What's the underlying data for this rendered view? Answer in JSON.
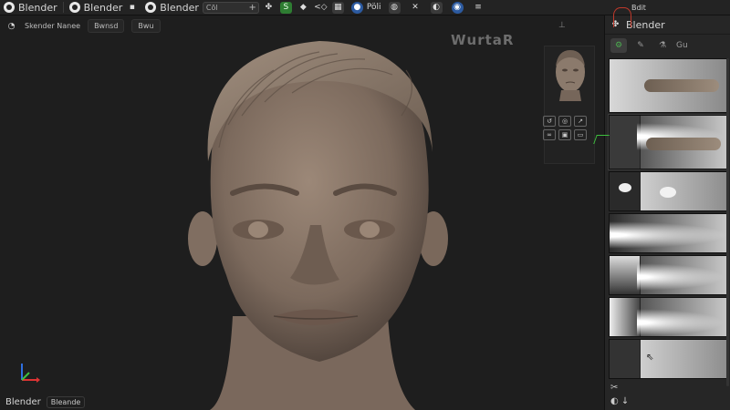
{
  "topbar": {
    "app_label_1": "Blender",
    "app_label_2": "Blender",
    "app_label_3": "Blender",
    "search_value": "Cõl",
    "right_label": "Pöli",
    "panel_label": "Bdit"
  },
  "viewport": {
    "header_left": "Skender Nanee",
    "header_chip": "Bwnsd",
    "header_chip_2": "Bwu",
    "watermark": "WurtaR",
    "footer_label": "Blender",
    "footer_sub": "Bleande"
  },
  "panel": {
    "title": "Blender",
    "tab_label": "Gu"
  },
  "colors": {
    "accent_green": "#4caf50",
    "header_bg": "#232323",
    "viewport_bg": "#1e1e1e",
    "skin": "#8a786a"
  }
}
